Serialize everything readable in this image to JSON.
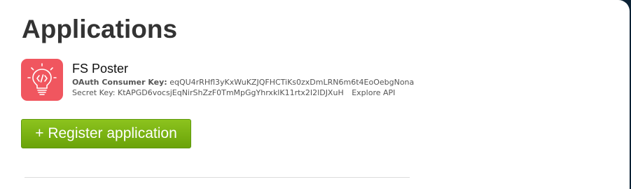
{
  "page": {
    "title": "Applications"
  },
  "app": {
    "icon": "lightbulb-code-icon",
    "name": "FS Poster",
    "consumer_key_label": "OAuth Consumer Key:",
    "consumer_key_value": "eqQU4rRHfl3yKxWuKZJQFHCTiKs0zxDmLRN6m6t4EoOebgNona",
    "secret_key_label": "Secret Key:",
    "secret_key_value": "KtAPGD6vocsjEqNirShZzF0TmMpGgYhrxklK11rtx2I2lDJXuH",
    "explore_label": "Explore API"
  },
  "actions": {
    "register_label": "+ Register application"
  },
  "colors": {
    "icon_bg": "#f0565f",
    "button_green": "#7ab317",
    "frame_bg": "#0b2235"
  }
}
